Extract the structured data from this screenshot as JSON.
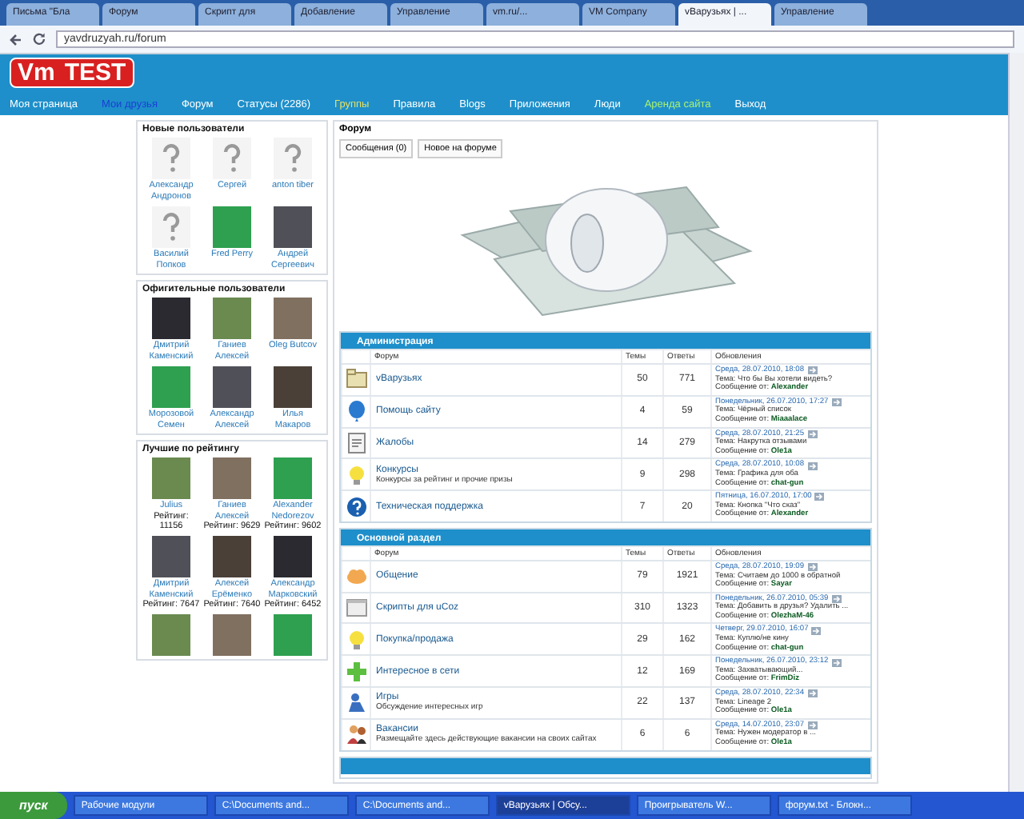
{
  "browser": {
    "tabs": [
      {
        "title": "Письма \"Бла",
        "selected": false
      },
      {
        "title": "Форум",
        "selected": false
      },
      {
        "title": "Скрипт для",
        "selected": false
      },
      {
        "title": "Добавление",
        "selected": false
      },
      {
        "title": "Управление",
        "selected": false
      },
      {
        "title": "vm.ru/...",
        "selected": false
      },
      {
        "title": "VM Company",
        "selected": false
      },
      {
        "title": "vВарузьях | ...",
        "selected": true
      },
      {
        "title": "Управление",
        "selected": false
      }
    ],
    "url": "yavdruzyah.ru/forum"
  },
  "site": {
    "logo": {
      "part_1": "Vm",
      "part_2": "TEST"
    },
    "nav": [
      {
        "label": "Моя страница",
        "color": "#ffffff"
      },
      {
        "label": "Мои друзья",
        "color": "#1a3fd6"
      },
      {
        "label": "Форум",
        "color": "#ffffff"
      },
      {
        "label": "Статусы (2286)",
        "color": "#ffffff"
      },
      {
        "label": "Группы",
        "color": "#e8e060"
      },
      {
        "label": "Правила",
        "color": "#ffffff"
      },
      {
        "label": "Blogs",
        "color": "#ffffff"
      },
      {
        "label": "Приложения",
        "color": "#ffffff"
      },
      {
        "label": "Люди",
        "color": "#ffffff"
      },
      {
        "label": "Аренда сайта",
        "color": "#a8f070"
      },
      {
        "label": "Выход",
        "color": "#ffffff"
      }
    ]
  },
  "sidebar": [
    {
      "title": "Новые пользователи",
      "users": [
        {
          "name": "Александр Андронов",
          "kind": "placeholder"
        },
        {
          "name": "Сергей",
          "kind": "placeholder"
        },
        {
          "name": "anton tiber",
          "kind": "placeholder"
        },
        {
          "name": "Василий Попков",
          "kind": "placeholder"
        },
        {
          "name": "Fred Perry",
          "kind": "photo"
        },
        {
          "name": "Андрей Сергеевич",
          "kind": "photo"
        }
      ]
    },
    {
      "title": "Офигительные пользователи",
      "users": [
        {
          "name": "Дмитрий Каменский",
          "kind": "photo"
        },
        {
          "name": "Ганиев Алексей",
          "kind": "photo"
        },
        {
          "name": "Oleg Butcov",
          "kind": "photo"
        },
        {
          "name": "Морозовой Семен",
          "kind": "photo"
        },
        {
          "name": "Александр Алексей",
          "kind": "photo"
        },
        {
          "name": "Илья Макаров",
          "kind": "photo"
        }
      ]
    },
    {
      "title": "Лучшие по рейтингу",
      "users": [
        {
          "name": "Julius",
          "kind": "photo",
          "rating": "Рейтинг: 11156"
        },
        {
          "name": "Ганиев Алексей",
          "kind": "photo",
          "rating": "Рейтинг: 9629"
        },
        {
          "name": "Alexander Nedorezov",
          "kind": "photo",
          "rating": "Рейтинг: 9602"
        },
        {
          "name": "Дмитрий Каменский",
          "kind": "photo",
          "rating": "Рейтинг: 7647"
        },
        {
          "name": "Алексей Ерёменко",
          "kind": "photo",
          "rating": "Рейтинг: 7640"
        },
        {
          "name": "Александр Марковский",
          "kind": "photo",
          "rating": "Рейтинг: 6452"
        },
        {
          "kind": "photo"
        },
        {
          "kind": "photo"
        },
        {
          "kind": "photo"
        }
      ]
    }
  ],
  "forum": {
    "title": "Форум",
    "buttons": [
      "Сообщения (0)",
      "Новое на форуме"
    ],
    "sections": [
      {
        "title": "Администрация",
        "columns": [
          "Форум",
          "Темы",
          "Ответы",
          "Обновления"
        ],
        "rows": [
          {
            "kind": "folder",
            "name": "vВарузьях",
            "topics": "50",
            "replies": "771",
            "date": "Среда, 28.07.2010, 18:08",
            "topic": "Тема: Что бы Вы хотели видеть?",
            "author": "Сообщение от: **Alexander**"
          },
          {
            "kind": "balloon",
            "name": "Помощь сайту",
            "topics": "4",
            "replies": "59",
            "date": "Понедельник, 26.07.2010, 17:27",
            "topic": "Тема: Чёрный список",
            "author": "Сообщение от: **Miaaalace**"
          },
          {
            "kind": "document",
            "name": "Жалобы",
            "topics": "14",
            "replies": "279",
            "date": "Среда, 28.07.2010, 21:25",
            "topic": "Тема: Накрутка отзывами",
            "author": "Сообщение от: **Ole1a**"
          },
          {
            "kind": "bulb",
            "name": "Конкурсы",
            "description": "Конкурсы за рейтинг и прочие призы",
            "topics": "9",
            "replies": "298",
            "date": "Среда, 28.07.2010, 10:08",
            "topic": "Тема: Графика для оба",
            "author": "Сообщение от: **chat-gun**"
          },
          {
            "kind": "help",
            "name": "Техническая поддержка",
            "topics": "7",
            "replies": "20",
            "date": "Пятница, 16.07.2010, 17:00",
            "topic": "Тема: Кнопка \"Что сказ\"",
            "author": "Сообщение от: **Alexander**"
          }
        ]
      },
      {
        "title": "Основной раздел",
        "columns": [
          "Форум",
          "Темы",
          "Ответы",
          "Обновления"
        ],
        "rows": [
          {
            "kind": "cloud",
            "name": "Общение",
            "topics": "79",
            "replies": "1921",
            "date": "Среда, 28.07.2010, 19:09",
            "topic": "Тема: Считаем до 1000 в обратной",
            "author": "Сообщение от: **Sayar**"
          },
          {
            "kind": "window",
            "name": "Скрипты для uCoz",
            "topics": "310",
            "replies": "1323",
            "date": "Понедельник, 26.07.2010, 05:39",
            "topic": "Тема: Добавить в друзья? Удалить ...",
            "author": "Сообщение от: **OlezhaM-46**"
          },
          {
            "kind": "bulb",
            "name": "Покупка/продажа",
            "topics": "29",
            "replies": "162",
            "date": "Четверг, 29.07.2010, 16:07",
            "topic": "Тема: Куплю/не кину",
            "author": "Сообщение от: **chat-gun**"
          },
          {
            "kind": "plus",
            "name": "Интересное в сети",
            "topics": "12",
            "replies": "169",
            "date": "Понедельник, 26.07.2010, 23:12",
            "topic": "Тема: Захватывающий...",
            "author": "Сообщение от: **FrimDiz**"
          },
          {
            "kind": "game",
            "name": "Игры",
            "description": "Обсуждение интересных игр",
            "topics": "22",
            "replies": "137",
            "date": "Среда, 28.07.2010, 22:34",
            "topic": "Тема: Lineage 2",
            "author": "Сообщение от: **Ole1a**"
          },
          {
            "kind": "people",
            "name": "Вакансии",
            "description": "Размещайте здесь действующие вакансии на своих сайтах",
            "topics": "6",
            "replies": "6",
            "date": "Среда, 14.07.2010, 23:07",
            "topic": "Тема: Нужен модератор в ...",
            "author": "Сообщение от: **Ole1a**"
          }
        ]
      }
    ]
  },
  "taskbar": {
    "start": "пуск",
    "items": [
      {
        "label": "Рабочие модули",
        "selected": false
      },
      {
        "label": "C:\\Documents and...",
        "selected": false
      },
      {
        "label": "C:\\Documents and...",
        "selected": false
      },
      {
        "label": "vВарузьях | Обсу...",
        "selected": true
      },
      {
        "label": "Проигрыватель W...",
        "selected": false
      },
      {
        "label": "форум.txt - Блокн...",
        "selected": false
      }
    ]
  }
}
